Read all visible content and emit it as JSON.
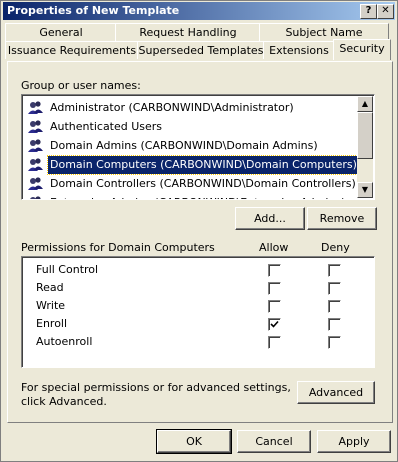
{
  "window": {
    "title": "Properties of New Template",
    "help_label": "?",
    "close_label": "✕"
  },
  "tabs": {
    "row1": [
      "General",
      "Request Handling",
      "Subject Name"
    ],
    "row2": [
      "Issuance Requirements",
      "Superseded Templates",
      "Extensions",
      "Security"
    ],
    "active": "Security"
  },
  "groups": {
    "label": "Group or user names:",
    "items": [
      "Administrator (CARBONWIND\\Administrator)",
      "Authenticated Users",
      "Domain Admins (CARBONWIND\\Domain Admins)",
      "Domain Computers (CARBONWIND\\Domain Computers)",
      "Domain Controllers (CARBONWIND\\Domain Controllers)",
      "Enterprise Admins (CARBONWIND\\Enterprise Admins)"
    ],
    "selected_index": 3
  },
  "buttons": {
    "add": "Add...",
    "remove": "Remove",
    "advanced": "Advanced",
    "ok": "OK",
    "cancel": "Cancel",
    "apply": "Apply"
  },
  "permissions": {
    "label": "Permissions for Domain Computers",
    "allow_header": "Allow",
    "deny_header": "Deny",
    "rows": [
      {
        "name": "Full Control",
        "allow": false,
        "deny": false
      },
      {
        "name": "Read",
        "allow": false,
        "deny": false
      },
      {
        "name": "Write",
        "allow": false,
        "deny": false
      },
      {
        "name": "Enroll",
        "allow": true,
        "deny": false
      },
      {
        "name": "Autoenroll",
        "allow": false,
        "deny": false
      }
    ]
  },
  "advanced_note": {
    "line1": "For special permissions or for advanced settings,",
    "line2": "click Advanced."
  }
}
